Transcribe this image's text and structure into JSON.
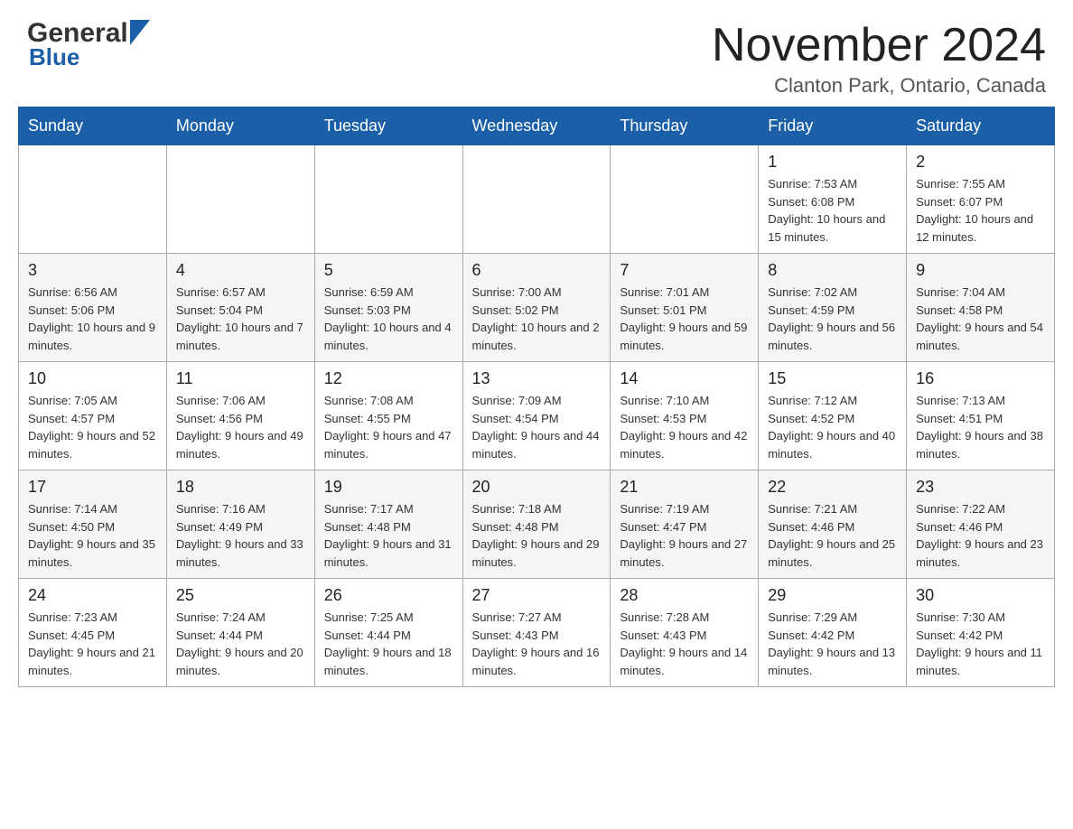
{
  "header": {
    "logo_general": "General",
    "logo_blue": "Blue",
    "title": "November 2024",
    "location": "Clanton Park, Ontario, Canada"
  },
  "weekdays": [
    "Sunday",
    "Monday",
    "Tuesday",
    "Wednesday",
    "Thursday",
    "Friday",
    "Saturday"
  ],
  "weeks": [
    [
      {
        "day": "",
        "info": ""
      },
      {
        "day": "",
        "info": ""
      },
      {
        "day": "",
        "info": ""
      },
      {
        "day": "",
        "info": ""
      },
      {
        "day": "",
        "info": ""
      },
      {
        "day": "1",
        "info": "Sunrise: 7:53 AM\nSunset: 6:08 PM\nDaylight: 10 hours and 15 minutes."
      },
      {
        "day": "2",
        "info": "Sunrise: 7:55 AM\nSunset: 6:07 PM\nDaylight: 10 hours and 12 minutes."
      }
    ],
    [
      {
        "day": "3",
        "info": "Sunrise: 6:56 AM\nSunset: 5:06 PM\nDaylight: 10 hours and 9 minutes."
      },
      {
        "day": "4",
        "info": "Sunrise: 6:57 AM\nSunset: 5:04 PM\nDaylight: 10 hours and 7 minutes."
      },
      {
        "day": "5",
        "info": "Sunrise: 6:59 AM\nSunset: 5:03 PM\nDaylight: 10 hours and 4 minutes."
      },
      {
        "day": "6",
        "info": "Sunrise: 7:00 AM\nSunset: 5:02 PM\nDaylight: 10 hours and 2 minutes."
      },
      {
        "day": "7",
        "info": "Sunrise: 7:01 AM\nSunset: 5:01 PM\nDaylight: 9 hours and 59 minutes."
      },
      {
        "day": "8",
        "info": "Sunrise: 7:02 AM\nSunset: 4:59 PM\nDaylight: 9 hours and 56 minutes."
      },
      {
        "day": "9",
        "info": "Sunrise: 7:04 AM\nSunset: 4:58 PM\nDaylight: 9 hours and 54 minutes."
      }
    ],
    [
      {
        "day": "10",
        "info": "Sunrise: 7:05 AM\nSunset: 4:57 PM\nDaylight: 9 hours and 52 minutes."
      },
      {
        "day": "11",
        "info": "Sunrise: 7:06 AM\nSunset: 4:56 PM\nDaylight: 9 hours and 49 minutes."
      },
      {
        "day": "12",
        "info": "Sunrise: 7:08 AM\nSunset: 4:55 PM\nDaylight: 9 hours and 47 minutes."
      },
      {
        "day": "13",
        "info": "Sunrise: 7:09 AM\nSunset: 4:54 PM\nDaylight: 9 hours and 44 minutes."
      },
      {
        "day": "14",
        "info": "Sunrise: 7:10 AM\nSunset: 4:53 PM\nDaylight: 9 hours and 42 minutes."
      },
      {
        "day": "15",
        "info": "Sunrise: 7:12 AM\nSunset: 4:52 PM\nDaylight: 9 hours and 40 minutes."
      },
      {
        "day": "16",
        "info": "Sunrise: 7:13 AM\nSunset: 4:51 PM\nDaylight: 9 hours and 38 minutes."
      }
    ],
    [
      {
        "day": "17",
        "info": "Sunrise: 7:14 AM\nSunset: 4:50 PM\nDaylight: 9 hours and 35 minutes."
      },
      {
        "day": "18",
        "info": "Sunrise: 7:16 AM\nSunset: 4:49 PM\nDaylight: 9 hours and 33 minutes."
      },
      {
        "day": "19",
        "info": "Sunrise: 7:17 AM\nSunset: 4:48 PM\nDaylight: 9 hours and 31 minutes."
      },
      {
        "day": "20",
        "info": "Sunrise: 7:18 AM\nSunset: 4:48 PM\nDaylight: 9 hours and 29 minutes."
      },
      {
        "day": "21",
        "info": "Sunrise: 7:19 AM\nSunset: 4:47 PM\nDaylight: 9 hours and 27 minutes."
      },
      {
        "day": "22",
        "info": "Sunrise: 7:21 AM\nSunset: 4:46 PM\nDaylight: 9 hours and 25 minutes."
      },
      {
        "day": "23",
        "info": "Sunrise: 7:22 AM\nSunset: 4:46 PM\nDaylight: 9 hours and 23 minutes."
      }
    ],
    [
      {
        "day": "24",
        "info": "Sunrise: 7:23 AM\nSunset: 4:45 PM\nDaylight: 9 hours and 21 minutes."
      },
      {
        "day": "25",
        "info": "Sunrise: 7:24 AM\nSunset: 4:44 PM\nDaylight: 9 hours and 20 minutes."
      },
      {
        "day": "26",
        "info": "Sunrise: 7:25 AM\nSunset: 4:44 PM\nDaylight: 9 hours and 18 minutes."
      },
      {
        "day": "27",
        "info": "Sunrise: 7:27 AM\nSunset: 4:43 PM\nDaylight: 9 hours and 16 minutes."
      },
      {
        "day": "28",
        "info": "Sunrise: 7:28 AM\nSunset: 4:43 PM\nDaylight: 9 hours and 14 minutes."
      },
      {
        "day": "29",
        "info": "Sunrise: 7:29 AM\nSunset: 4:42 PM\nDaylight: 9 hours and 13 minutes."
      },
      {
        "day": "30",
        "info": "Sunrise: 7:30 AM\nSunset: 4:42 PM\nDaylight: 9 hours and 11 minutes."
      }
    ]
  ]
}
